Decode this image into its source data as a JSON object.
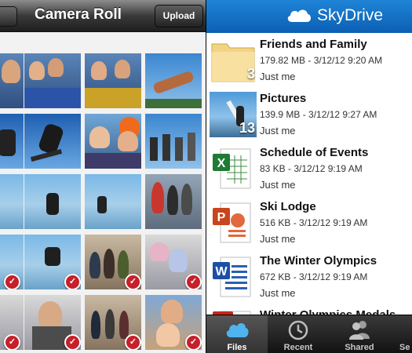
{
  "camera_roll": {
    "title": "Camera Roll",
    "upload_label": "Upload",
    "check_glyph": "✓"
  },
  "skydrive": {
    "app_title": "SkyDrive",
    "items": [
      {
        "name": "Friends and Family",
        "meta": "179.82 MB - 3/12/12 9:20 AM",
        "owner": "Just me",
        "type": "folder",
        "count": "3"
      },
      {
        "name": "Pictures",
        "meta": "139.9 MB - 3/12/12 9:27 AM",
        "owner": "Just me",
        "type": "photo-folder",
        "count": "13"
      },
      {
        "name": "Schedule of Events",
        "meta": "83 KB - 3/12/12 9:19 AM",
        "owner": "Just me",
        "type": "excel"
      },
      {
        "name": "Ski Lodge",
        "meta": "516 KB - 3/12/12 9:19 AM",
        "owner": "Just me",
        "type": "powerpoint"
      },
      {
        "name": "The Winter Olympics",
        "meta": "672 KB - 3/12/12 9:19 AM",
        "owner": "Just me",
        "type": "word"
      },
      {
        "name": "Winter Olympics Medals",
        "type": "pdf"
      }
    ],
    "tabs": [
      {
        "label": "Files",
        "active": true
      },
      {
        "label": "Recent",
        "active": false
      },
      {
        "label": "Shared",
        "active": false
      },
      {
        "label": "Se",
        "active": false
      }
    ],
    "accent_color": "#0b6cc5"
  }
}
